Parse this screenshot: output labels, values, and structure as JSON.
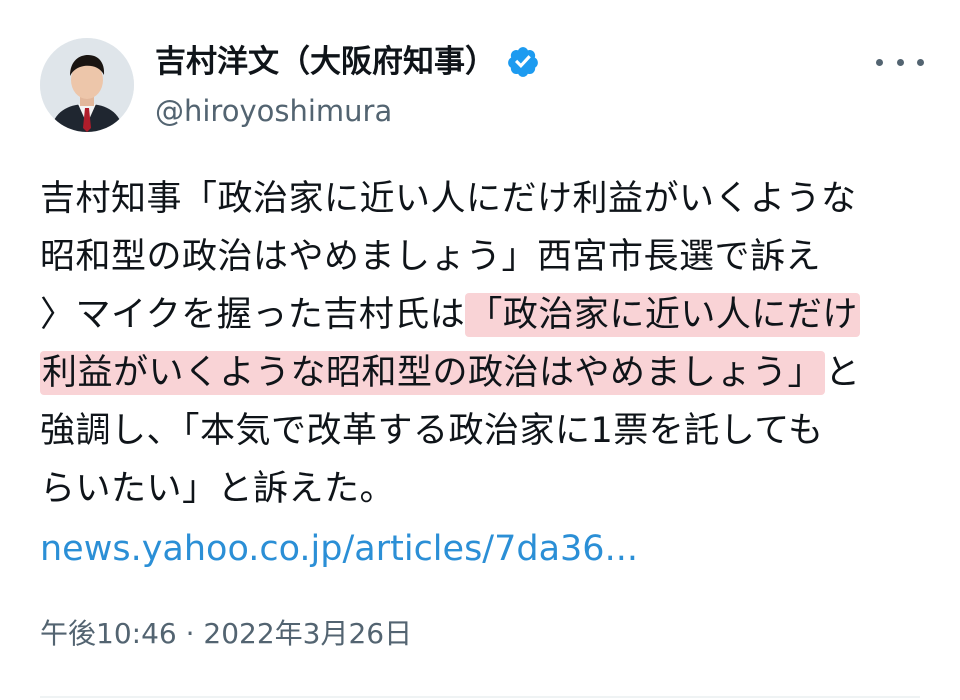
{
  "author": {
    "display_name": "吉村洋文（大阪府知事）",
    "handle": "@hiroyoshimura",
    "verified": true
  },
  "tweet": {
    "lines": [
      [
        {
          "text": "吉村知事「政治家に近い人にだけ利益がいくような",
          "highlight": false
        }
      ],
      [
        {
          "text": "昭和型の政治はやめましょう」西宮市長選で訴え",
          "highlight": false
        }
      ],
      [
        {
          "text": "〉マイクを握った吉村氏は",
          "highlight": false
        },
        {
          "text": "「政治家に近い人にだけ",
          "highlight": true
        }
      ],
      [
        {
          "text": "利益がいくような昭和型の政治はやめましょう」",
          "highlight": true
        },
        {
          "text": "と",
          "highlight": false
        }
      ],
      [
        {
          "text": "強調し、「本気で改革する政治家に1票を託しても",
          "highlight": false
        }
      ],
      [
        {
          "text": "らいたい」と訴えた。",
          "highlight": false
        }
      ]
    ],
    "link_text": "news.yahoo.co.jp/articles/7da36...",
    "timestamp": "午後10:46 · 2022年3月26日"
  },
  "colors": {
    "text": "#0f1419",
    "secondary": "#536471",
    "link": "#2b8fd6",
    "verified": "#1d9bf0",
    "highlight": "#f9d3d6"
  },
  "icons": {
    "verified": "verified-badge-icon",
    "more": "more-options-icon"
  }
}
